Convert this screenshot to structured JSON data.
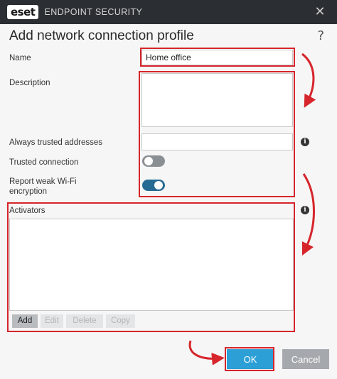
{
  "window": {
    "logo_text": "eset",
    "product_name": "ENDPOINT SECURITY",
    "close_glyph": "✕"
  },
  "dialog": {
    "title": "Add network connection profile",
    "help_glyph": "?"
  },
  "form": {
    "name_label": "Name",
    "name_value": "Home office",
    "description_label": "Description",
    "description_value": "",
    "trusted_addresses_label": "Always trusted addresses",
    "trusted_addresses_value": "",
    "trusted_connection_label": "Trusted connection",
    "trusted_connection_on": false,
    "weak_wifi_label_line1": "Report weak Wi-Fi",
    "weak_wifi_label_line2": "encryption",
    "weak_wifi_on": true
  },
  "activators": {
    "label": "Activators",
    "buttons": {
      "add": "Add",
      "edit": "Edit",
      "delete": "Delete",
      "copy": "Copy"
    }
  },
  "footer": {
    "ok_label": "OK",
    "cancel_label": "Cancel"
  },
  "colors": {
    "titlebar": "#2b2f33",
    "highlight": "#d6252b",
    "ok_button": "#2b9fd6",
    "toggle_on": "#256b94",
    "toggle_off": "#8a8f94"
  },
  "icons": {
    "info": "info-icon",
    "help": "help-icon",
    "close": "close-icon"
  }
}
